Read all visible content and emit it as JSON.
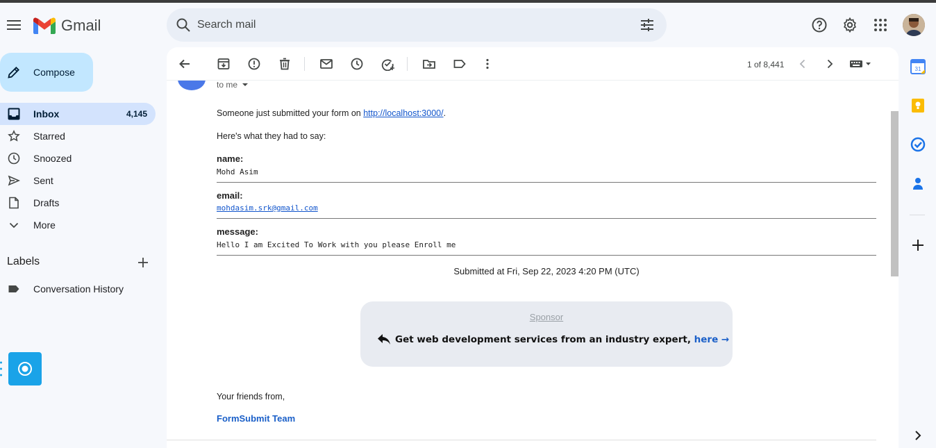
{
  "app": {
    "name": "Gmail"
  },
  "search": {
    "placeholder": "Search mail"
  },
  "compose": {
    "label": "Compose"
  },
  "nav": [
    {
      "label": "Inbox",
      "count": "4,145",
      "icon": "inbox-icon",
      "active": true
    },
    {
      "label": "Starred",
      "count": "",
      "icon": "star-icon"
    },
    {
      "label": "Snoozed",
      "count": "",
      "icon": "clock-icon"
    },
    {
      "label": "Sent",
      "count": "",
      "icon": "send-icon"
    },
    {
      "label": "Drafts",
      "count": "",
      "icon": "draft-icon"
    },
    {
      "label": "More",
      "count": "",
      "icon": "chevron-down-icon"
    }
  ],
  "labels": {
    "title": "Labels",
    "items": [
      {
        "label": "Conversation History",
        "icon": "label-icon"
      }
    ]
  },
  "toolbar": {
    "icons": [
      "back-icon",
      "archive-icon",
      "report-spam-icon",
      "delete-icon",
      "mark-unread-icon",
      "snooze-icon",
      "add-task-icon",
      "move-to-icon",
      "label-icon",
      "more-vert-icon"
    ],
    "pager": "1 of 8,441"
  },
  "email": {
    "recipient": "to me",
    "intro_prefix": "Someone just submitted your form on ",
    "intro_link": "http://localhost:3000/",
    "intro_suffix": ".",
    "say": "Here's what they had to say:",
    "fields": [
      {
        "name": "name:",
        "value": "Mohd Asim",
        "is_link": false
      },
      {
        "name": "email:",
        "value": "mohdasim.srk@gmail.com",
        "is_link": true
      },
      {
        "name": "message:",
        "value": "Hello I am Excited To Work with you please Enroll me",
        "is_link": false
      }
    ],
    "submitted": "Submitted at Fri, Sep 22, 2023 4:20 PM (UTC)",
    "sponsor": {
      "label": "Sponsor",
      "text": "Get web development services from an industry expert, ",
      "link": "here →"
    },
    "closing": "Your friends from,",
    "team": "FormSubmit Team"
  },
  "side_panel": [
    "calendar-icon",
    "keep-icon",
    "tasks-icon",
    "contacts-icon",
    "add-icon"
  ],
  "colors": {
    "accent": "#c2e7ff",
    "active_nav": "#d3e3fd",
    "link": "#1155cc",
    "fab": "#1aa3e8"
  }
}
